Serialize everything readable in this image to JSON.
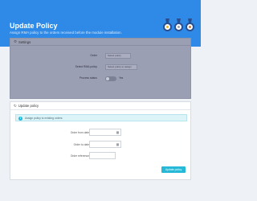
{
  "header": {
    "title": "Update Policy",
    "subtitle": "Assign RMA policy to the orders received before the module installation.",
    "medals": [
      "gold-medal",
      "silver-medal",
      "bronze-medal"
    ]
  },
  "settings_panel": {
    "title": "Settings",
    "fields": [
      {
        "label": "Order",
        "value": "Select policy"
      },
      {
        "label": "Select RMA policy",
        "value": "Select policy to assign"
      },
      {
        "label": "Process status",
        "value": "Yes"
      }
    ]
  },
  "update_policy": {
    "title": "Update policy",
    "info": "Assign policy to existing orders",
    "fields": [
      {
        "label": "Order from date",
        "value": ""
      },
      {
        "label": "Order to date",
        "value": ""
      },
      {
        "label": "Order reference",
        "value": ""
      }
    ],
    "button_label": "Update policy"
  },
  "colors": {
    "header_bg": "#2e8ae6",
    "accent": "#25b9d7"
  }
}
